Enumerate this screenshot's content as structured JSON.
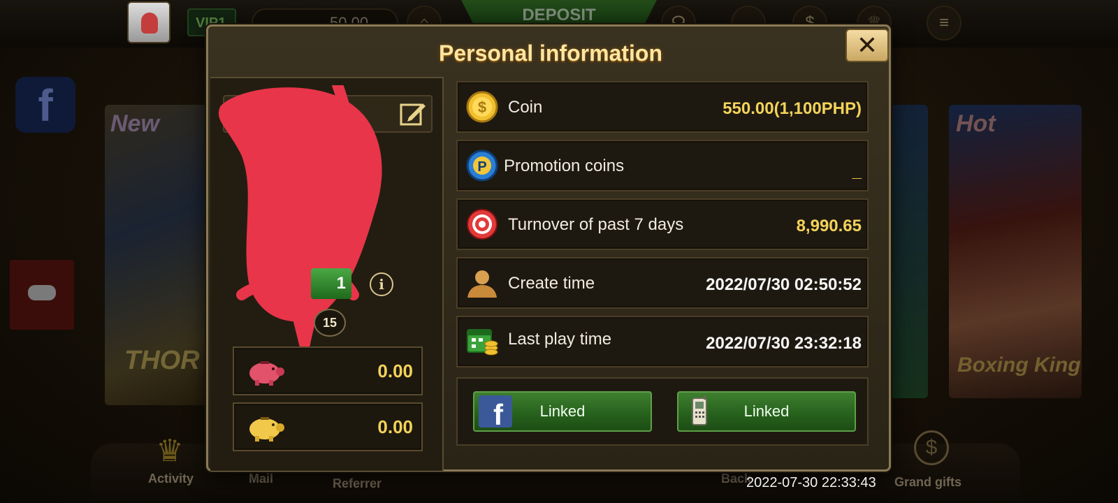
{
  "modal": {
    "title": "Personal information",
    "close_label": "✕"
  },
  "profile": {
    "vip_level_digit": "1",
    "level_number": "15",
    "info_icon": "i",
    "wallets": [
      {
        "icon": "pink-piggy-bank-icon",
        "amount": "0.00"
      },
      {
        "icon": "gold-piggy-bank-icon",
        "amount": "0.00"
      }
    ]
  },
  "details": [
    {
      "icon": "coin-icon",
      "label": "Coin",
      "value": "550.00(1,100PHP)"
    },
    {
      "icon": "promotion-coin-icon",
      "label": "Promotion coins",
      "value": "_"
    },
    {
      "icon": "poker-chip-icon",
      "label": "Turnover of past 7 days",
      "value": "8,990.65"
    },
    {
      "icon": "user-icon",
      "label": "Create time",
      "value": "2022/07/30 02:50:52"
    },
    {
      "icon": "calendar-coins-icon",
      "label": "Last play time",
      "value": "2022/07/30 23:32:18"
    }
  ],
  "links": {
    "facebook_label": "Linked",
    "phone_label": "Linked"
  },
  "background": {
    "top_vip": "VIP1",
    "top_balance": "50.00",
    "deposit_label": "DEPOSIT",
    "thor_tag": "New",
    "thor_title": "THOR",
    "boxing_tag": "Hot",
    "boxing_title": "Boxing King",
    "nav_activity": "Activity",
    "nav_mail": "Mail",
    "nav_referrer": "Referrer",
    "nav_back": "Back",
    "nav_grand_gifts": "Grand gifts"
  },
  "screenshot_timestamp": "2022-07-30 22:33:43",
  "colors": {
    "gold_text": "#f3d35a",
    "title_text": "#ffe6a0",
    "linked_green": "#2f6e24",
    "redaction": "#e8354a"
  }
}
